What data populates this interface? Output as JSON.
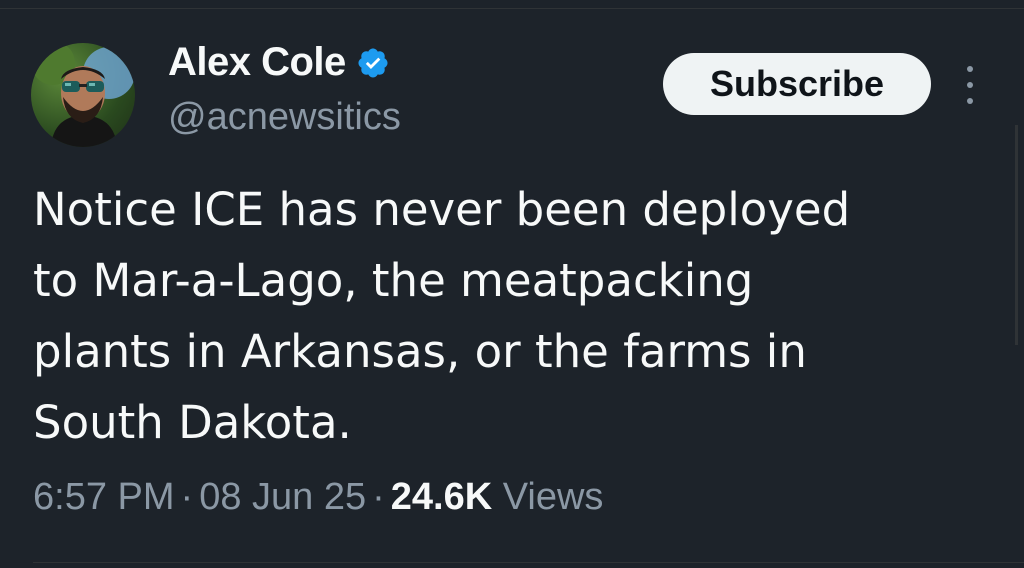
{
  "author": {
    "display_name": "Alex Cole",
    "handle": "@acnewsitics",
    "verified_icon": "verified-badge-icon",
    "badge_color": "#1d9bf0"
  },
  "actions": {
    "subscribe_label": "Subscribe",
    "more_icon": "more-vertical-icon"
  },
  "tweet": {
    "lines": [
      "Notice ICE has never been deployed",
      "to Mar-a-Lago, the meatpacking",
      "plants in Arkansas, or the farms in",
      "South Dakota."
    ],
    "time": "6:57 PM",
    "date": "08 Jun 25",
    "separator": "·",
    "views_count": "24.6K",
    "views_label": "Views"
  },
  "colors": {
    "background": "#1d232a",
    "text_primary": "#f7f9f9",
    "text_secondary": "#8b98a5",
    "button_bg": "#eff3f4"
  }
}
